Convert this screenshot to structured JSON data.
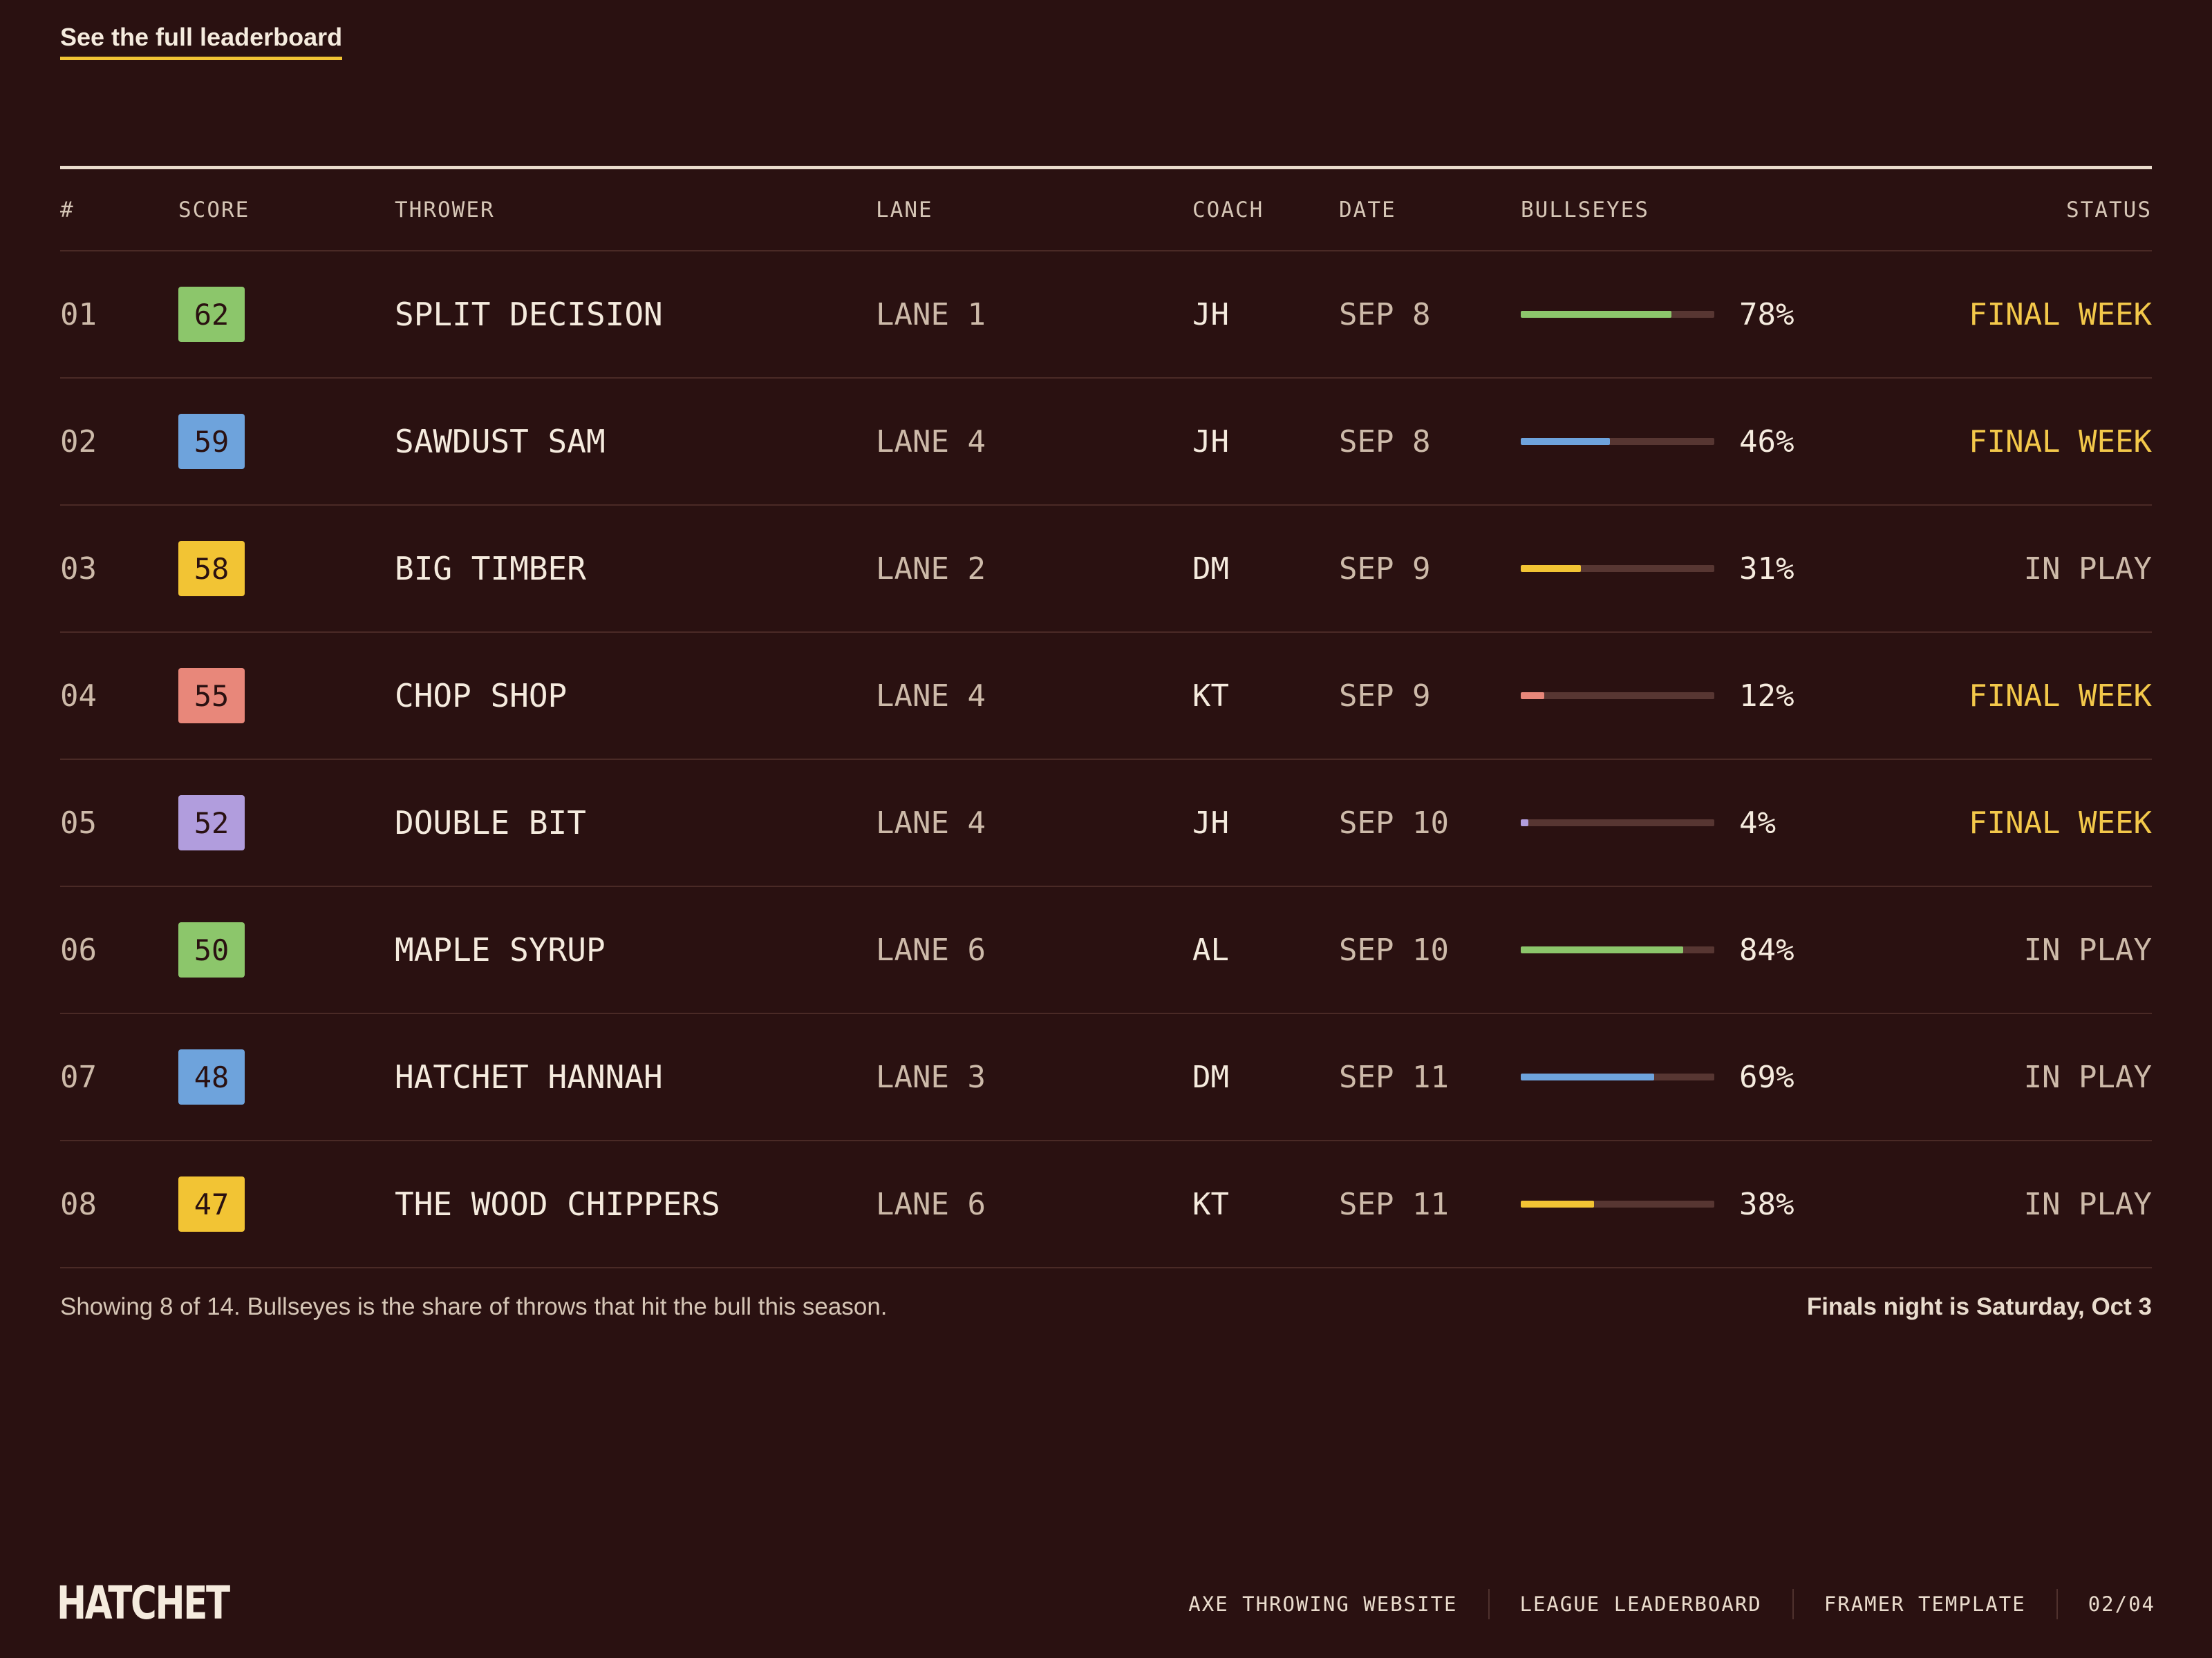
{
  "link": {
    "label": "See the full leaderboard"
  },
  "table": {
    "headers": {
      "num": "#",
      "score": "SCORE",
      "thrower": "THROWER",
      "lane": "LANE",
      "coach": "COACH",
      "date": "DATE",
      "bullseyes": "BULLSEYES",
      "status": "STATUS"
    },
    "rows": [
      {
        "num": "01",
        "score": "62",
        "score_color": "#8cc66b",
        "thrower": "SPLIT DECISION",
        "lane": "LANE 1",
        "coach": "JH",
        "date": "SEP 8",
        "bull_pct": 78,
        "bull_label": "78%",
        "bar_color": "#8cc66b",
        "status": "FINAL WEEK",
        "status_type": "final"
      },
      {
        "num": "02",
        "score": "59",
        "score_color": "#6ea3dc",
        "thrower": "SAWDUST SAM",
        "lane": "LANE 4",
        "coach": "JH",
        "date": "SEP 8",
        "bull_pct": 46,
        "bull_label": "46%",
        "bar_color": "#6ea3dc",
        "status": "FINAL WEEK",
        "status_type": "final"
      },
      {
        "num": "03",
        "score": "58",
        "score_color": "#f2c434",
        "thrower": "BIG TIMBER",
        "lane": "LANE 2",
        "coach": "DM",
        "date": "SEP 9",
        "bull_pct": 31,
        "bull_label": "31%",
        "bar_color": "#f2c434",
        "status": "IN PLAY",
        "status_type": "play"
      },
      {
        "num": "04",
        "score": "55",
        "score_color": "#e8877a",
        "thrower": "CHOP SHOP",
        "lane": "LANE 4",
        "coach": "KT",
        "date": "SEP 9",
        "bull_pct": 12,
        "bull_label": "12%",
        "bar_color": "#e8877a",
        "status": "FINAL WEEK",
        "status_type": "final"
      },
      {
        "num": "05",
        "score": "52",
        "score_color": "#b19ddd",
        "thrower": "DOUBLE BIT",
        "lane": "LANE 4",
        "coach": "JH",
        "date": "SEP 10",
        "bull_pct": 4,
        "bull_label": "4%",
        "bar_color": "#b19ddd",
        "status": "FINAL WEEK",
        "status_type": "final"
      },
      {
        "num": "06",
        "score": "50",
        "score_color": "#8cc66b",
        "thrower": "MAPLE SYRUP",
        "lane": "LANE 6",
        "coach": "AL",
        "date": "SEP 10",
        "bull_pct": 84,
        "bull_label": "84%",
        "bar_color": "#8cc66b",
        "status": "IN PLAY",
        "status_type": "play"
      },
      {
        "num": "07",
        "score": "48",
        "score_color": "#6ea3dc",
        "thrower": "HATCHET HANNAH",
        "lane": "LANE 3",
        "coach": "DM",
        "date": "SEP 11",
        "bull_pct": 69,
        "bull_label": "69%",
        "bar_color": "#6ea3dc",
        "status": "IN PLAY",
        "status_type": "play"
      },
      {
        "num": "08",
        "score": "47",
        "score_color": "#f2c434",
        "thrower": "THE WOOD CHIPPERS",
        "lane": "LANE 6",
        "coach": "KT",
        "date": "SEP 11",
        "bull_pct": 38,
        "bull_label": "38%",
        "bar_color": "#f2c434",
        "status": "IN PLAY",
        "status_type": "play"
      }
    ]
  },
  "notes": {
    "left": "Showing 8 of 14. Bullseyes is the share of throws that hit the bull this season.",
    "right": "Finals night is Saturday, Oct 3"
  },
  "footer": {
    "logo": "HATCHET",
    "items": [
      "AXE THROWING WEBSITE",
      "LEAGUE LEADERBOARD",
      "FRAMER TEMPLATE",
      "02/04"
    ]
  },
  "colors": {
    "background": "#2a1111",
    "accent": "#f2c434",
    "status_final": "#f3c84a"
  }
}
